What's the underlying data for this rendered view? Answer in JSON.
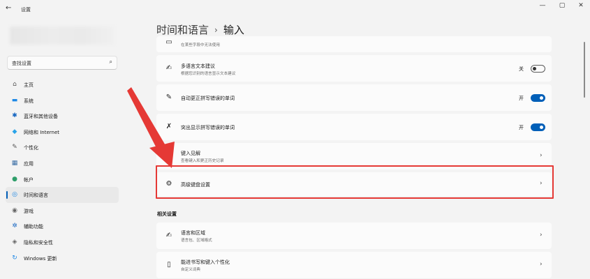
{
  "window": {
    "title": "设置",
    "back_icon": "←",
    "minimize_icon": "—",
    "maximize_icon": "▢",
    "close_icon": "✕"
  },
  "search": {
    "placeholder": "查找设置",
    "icon": "⌕"
  },
  "sidebar": {
    "items": [
      {
        "label": "主页",
        "icon": "⌂",
        "color": "#555555"
      },
      {
        "label": "系统",
        "icon": "▬",
        "color": "#1e88e5"
      },
      {
        "label": "蓝牙和其他设备",
        "icon": "✱",
        "color": "#1565c0"
      },
      {
        "label": "网络和 Internet",
        "icon": "◆",
        "color": "#29a3e8"
      },
      {
        "label": "个性化",
        "icon": "✎",
        "color": "#555555"
      },
      {
        "label": "应用",
        "icon": "▦",
        "color": "#3a6ea5"
      },
      {
        "label": "帐户",
        "icon": "●",
        "color": "#2e9e6a"
      },
      {
        "label": "时间和语言",
        "icon": "◎",
        "color": "#1e88e5",
        "selected": true
      },
      {
        "label": "游戏",
        "icon": "◉",
        "color": "#666666"
      },
      {
        "label": "辅助功能",
        "icon": "✲",
        "color": "#1565c0"
      },
      {
        "label": "隐私和安全性",
        "icon": "◈",
        "color": "#666666"
      },
      {
        "label": "Windows 更新",
        "icon": "↻",
        "color": "#1e88e5"
      }
    ]
  },
  "breadcrumb": {
    "parent": "时间和语言",
    "separator": "›",
    "current": "输入"
  },
  "cards": {
    "partial": {
      "subtitle": "在某些字段中无法使用",
      "icon": "▭"
    },
    "multilingual": {
      "title": "多语言文本建议",
      "subtitle": "根据您识别的语言显示文本建议",
      "state": "关",
      "icon": "✍"
    },
    "autocorrect": {
      "title": "自动更正拼写错误的单词",
      "state": "开",
      "icon": "✎"
    },
    "highlight_misspelled": {
      "title": "突出显示拼写错误的单词",
      "state": "开",
      "icon": "✗"
    },
    "typing_insights": {
      "title": "键入见解",
      "subtitle": "查看键入和更正历史记录",
      "icon": "◷"
    },
    "advanced_keyboard": {
      "title": "高级键盘设置",
      "icon": "⚙"
    }
  },
  "related": {
    "title": "相关设置",
    "items": [
      {
        "title": "语言和区域",
        "subtitle": "语言包、区域格式",
        "icon": "✍"
      },
      {
        "title": "能进书写和键入个性化",
        "subtitle": "自定义词典",
        "icon": "▯"
      }
    ]
  },
  "chevron": "›",
  "colors": {
    "accent": "#005fb8",
    "annotation": "#e53935",
    "background": "#f3f3f3",
    "card": "#fbfbfb"
  }
}
